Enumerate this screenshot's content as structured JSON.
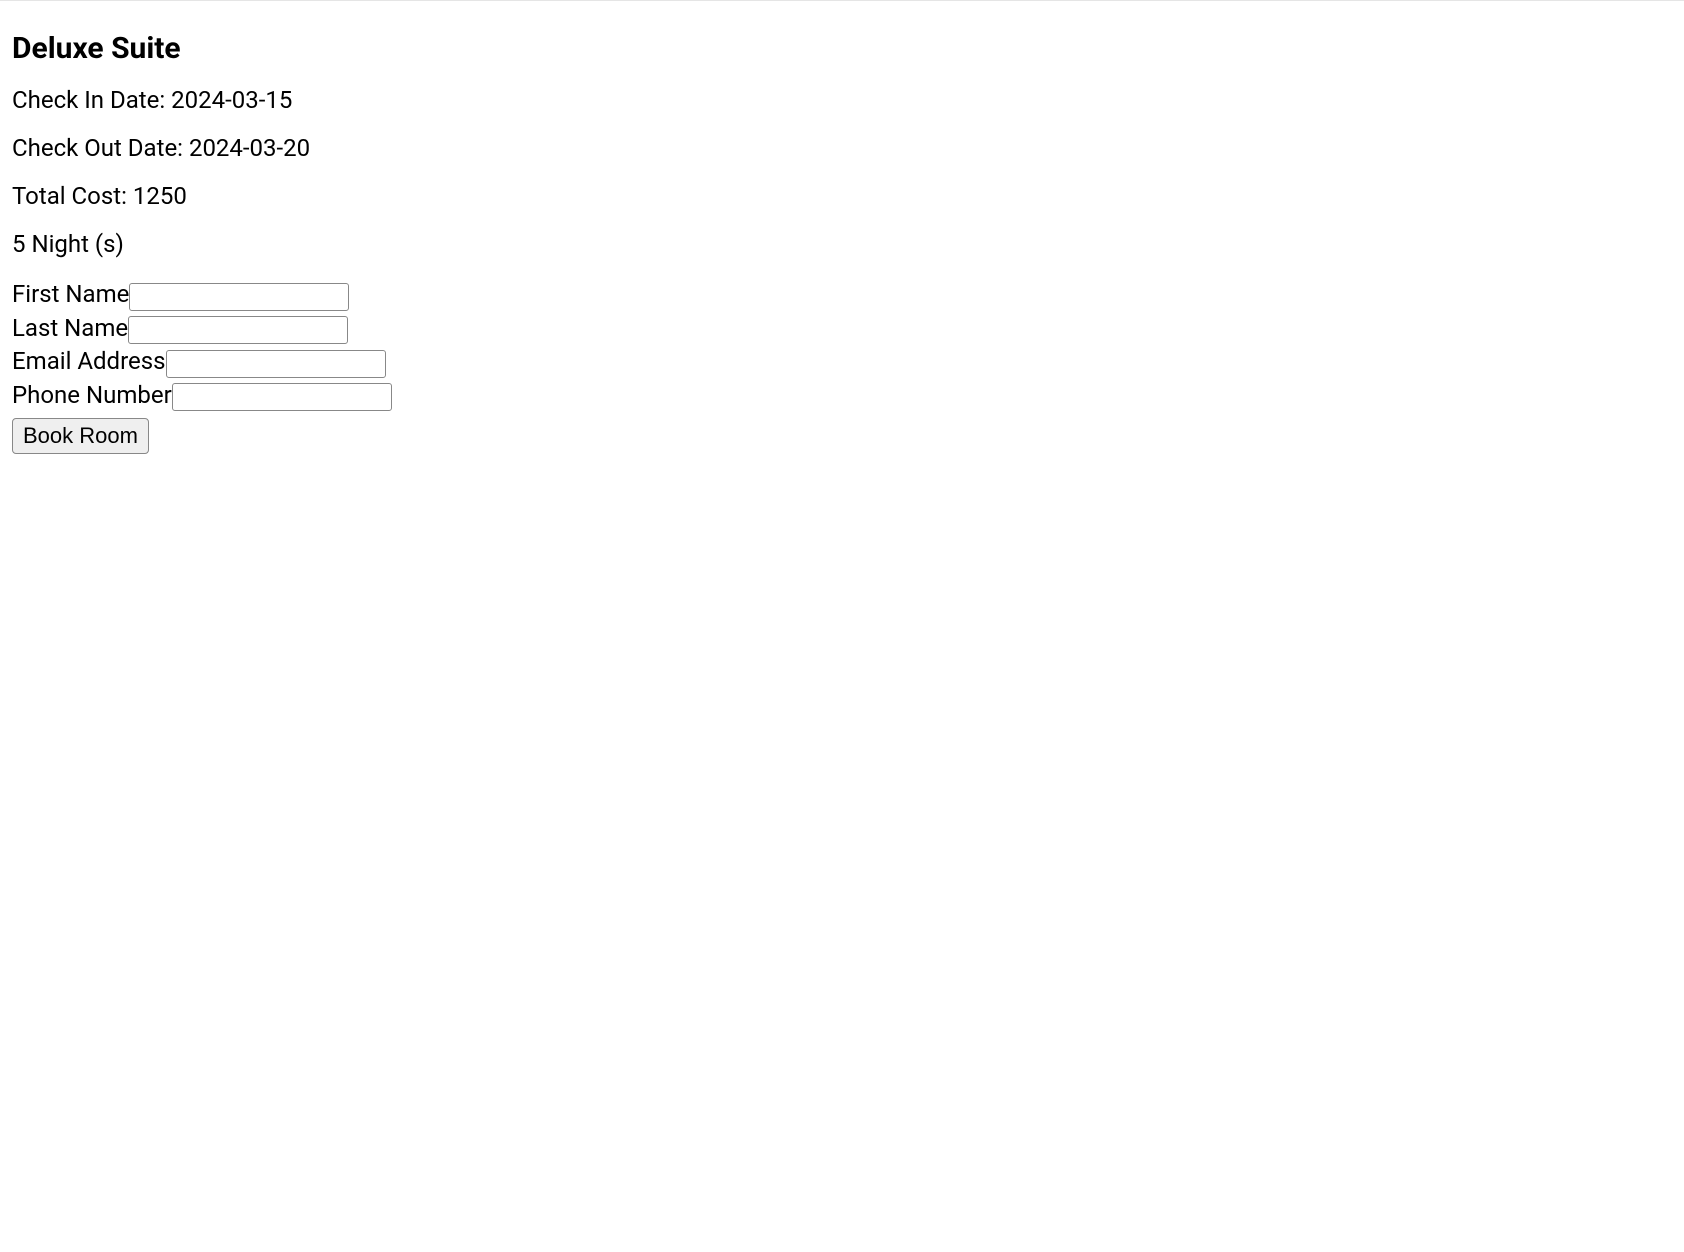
{
  "title": "Deluxe Suite",
  "summary": {
    "check_in_label": "Check In Date: ",
    "check_in_value": "2024-03-15",
    "check_out_label": "Check Out Date: ",
    "check_out_value": "2024-03-20",
    "total_cost_label": "Total Cost: ",
    "total_cost_value": "1250",
    "nights_text": "5 Night (s)"
  },
  "form": {
    "first_name_label": "First Name",
    "last_name_label": "Last Name",
    "email_label": "Email Address",
    "phone_label": "Phone Number",
    "first_name_value": "",
    "last_name_value": "",
    "email_value": "",
    "phone_value": "",
    "submit_label": "Book Room"
  }
}
